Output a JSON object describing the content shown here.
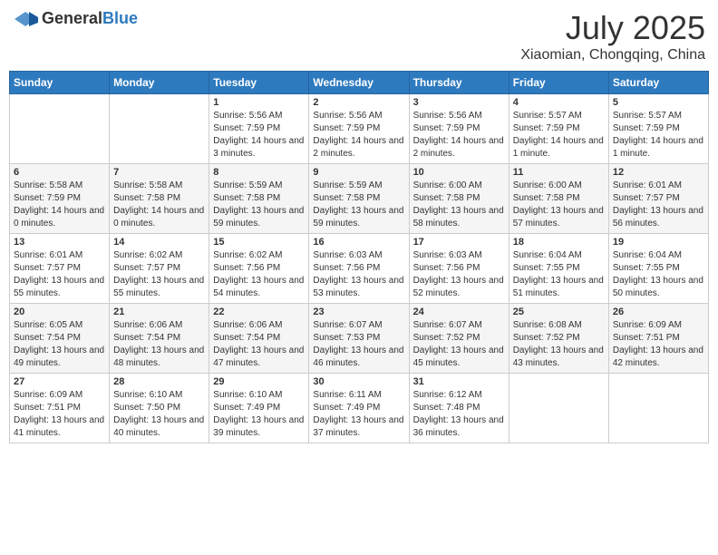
{
  "header": {
    "logo_general": "General",
    "logo_blue": "Blue",
    "month_year": "July 2025",
    "location": "Xiaomian, Chongqing, China"
  },
  "days_of_week": [
    "Sunday",
    "Monday",
    "Tuesday",
    "Wednesday",
    "Thursday",
    "Friday",
    "Saturday"
  ],
  "weeks": [
    [
      {
        "day": "",
        "detail": ""
      },
      {
        "day": "",
        "detail": ""
      },
      {
        "day": "1",
        "detail": "Sunrise: 5:56 AM\nSunset: 7:59 PM\nDaylight: 14 hours and 3 minutes."
      },
      {
        "day": "2",
        "detail": "Sunrise: 5:56 AM\nSunset: 7:59 PM\nDaylight: 14 hours and 2 minutes."
      },
      {
        "day": "3",
        "detail": "Sunrise: 5:56 AM\nSunset: 7:59 PM\nDaylight: 14 hours and 2 minutes."
      },
      {
        "day": "4",
        "detail": "Sunrise: 5:57 AM\nSunset: 7:59 PM\nDaylight: 14 hours and 1 minute."
      },
      {
        "day": "5",
        "detail": "Sunrise: 5:57 AM\nSunset: 7:59 PM\nDaylight: 14 hours and 1 minute."
      }
    ],
    [
      {
        "day": "6",
        "detail": "Sunrise: 5:58 AM\nSunset: 7:59 PM\nDaylight: 14 hours and 0 minutes."
      },
      {
        "day": "7",
        "detail": "Sunrise: 5:58 AM\nSunset: 7:58 PM\nDaylight: 14 hours and 0 minutes."
      },
      {
        "day": "8",
        "detail": "Sunrise: 5:59 AM\nSunset: 7:58 PM\nDaylight: 13 hours and 59 minutes."
      },
      {
        "day": "9",
        "detail": "Sunrise: 5:59 AM\nSunset: 7:58 PM\nDaylight: 13 hours and 59 minutes."
      },
      {
        "day": "10",
        "detail": "Sunrise: 6:00 AM\nSunset: 7:58 PM\nDaylight: 13 hours and 58 minutes."
      },
      {
        "day": "11",
        "detail": "Sunrise: 6:00 AM\nSunset: 7:58 PM\nDaylight: 13 hours and 57 minutes."
      },
      {
        "day": "12",
        "detail": "Sunrise: 6:01 AM\nSunset: 7:57 PM\nDaylight: 13 hours and 56 minutes."
      }
    ],
    [
      {
        "day": "13",
        "detail": "Sunrise: 6:01 AM\nSunset: 7:57 PM\nDaylight: 13 hours and 55 minutes."
      },
      {
        "day": "14",
        "detail": "Sunrise: 6:02 AM\nSunset: 7:57 PM\nDaylight: 13 hours and 55 minutes."
      },
      {
        "day": "15",
        "detail": "Sunrise: 6:02 AM\nSunset: 7:56 PM\nDaylight: 13 hours and 54 minutes."
      },
      {
        "day": "16",
        "detail": "Sunrise: 6:03 AM\nSunset: 7:56 PM\nDaylight: 13 hours and 53 minutes."
      },
      {
        "day": "17",
        "detail": "Sunrise: 6:03 AM\nSunset: 7:56 PM\nDaylight: 13 hours and 52 minutes."
      },
      {
        "day": "18",
        "detail": "Sunrise: 6:04 AM\nSunset: 7:55 PM\nDaylight: 13 hours and 51 minutes."
      },
      {
        "day": "19",
        "detail": "Sunrise: 6:04 AM\nSunset: 7:55 PM\nDaylight: 13 hours and 50 minutes."
      }
    ],
    [
      {
        "day": "20",
        "detail": "Sunrise: 6:05 AM\nSunset: 7:54 PM\nDaylight: 13 hours and 49 minutes."
      },
      {
        "day": "21",
        "detail": "Sunrise: 6:06 AM\nSunset: 7:54 PM\nDaylight: 13 hours and 48 minutes."
      },
      {
        "day": "22",
        "detail": "Sunrise: 6:06 AM\nSunset: 7:54 PM\nDaylight: 13 hours and 47 minutes."
      },
      {
        "day": "23",
        "detail": "Sunrise: 6:07 AM\nSunset: 7:53 PM\nDaylight: 13 hours and 46 minutes."
      },
      {
        "day": "24",
        "detail": "Sunrise: 6:07 AM\nSunset: 7:52 PM\nDaylight: 13 hours and 45 minutes."
      },
      {
        "day": "25",
        "detail": "Sunrise: 6:08 AM\nSunset: 7:52 PM\nDaylight: 13 hours and 43 minutes."
      },
      {
        "day": "26",
        "detail": "Sunrise: 6:09 AM\nSunset: 7:51 PM\nDaylight: 13 hours and 42 minutes."
      }
    ],
    [
      {
        "day": "27",
        "detail": "Sunrise: 6:09 AM\nSunset: 7:51 PM\nDaylight: 13 hours and 41 minutes."
      },
      {
        "day": "28",
        "detail": "Sunrise: 6:10 AM\nSunset: 7:50 PM\nDaylight: 13 hours and 40 minutes."
      },
      {
        "day": "29",
        "detail": "Sunrise: 6:10 AM\nSunset: 7:49 PM\nDaylight: 13 hours and 39 minutes."
      },
      {
        "day": "30",
        "detail": "Sunrise: 6:11 AM\nSunset: 7:49 PM\nDaylight: 13 hours and 37 minutes."
      },
      {
        "day": "31",
        "detail": "Sunrise: 6:12 AM\nSunset: 7:48 PM\nDaylight: 13 hours and 36 minutes."
      },
      {
        "day": "",
        "detail": ""
      },
      {
        "day": "",
        "detail": ""
      }
    ]
  ]
}
